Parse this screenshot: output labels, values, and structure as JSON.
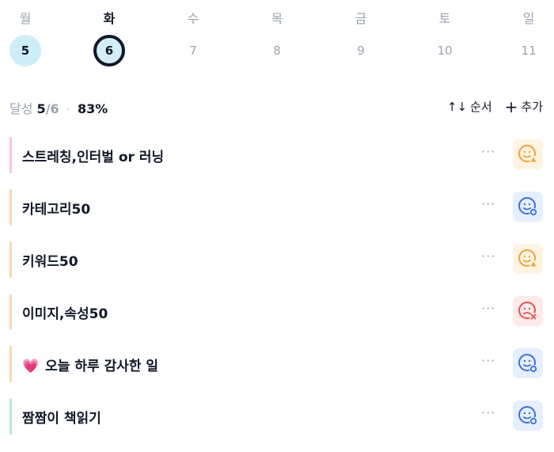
{
  "week": [
    {
      "day": "월",
      "date": "5",
      "state": "done"
    },
    {
      "day": "화",
      "date": "6",
      "state": "today"
    },
    {
      "day": "수",
      "date": "7",
      "state": "future"
    },
    {
      "day": "목",
      "date": "8",
      "state": "future"
    },
    {
      "day": "금",
      "date": "9",
      "state": "future"
    },
    {
      "day": "토",
      "date": "10",
      "state": "future"
    },
    {
      "day": "일",
      "date": "11",
      "state": "future"
    }
  ],
  "summary": {
    "label": "달성",
    "count": "5",
    "total": "/6",
    "separator": "·",
    "percent": "83%"
  },
  "toolbar": {
    "sort_icon": "↑↓",
    "sort_label": "순서",
    "add_icon": "+",
    "add_label": "추가"
  },
  "habits": [
    {
      "title": "스트레칭,인터벌 or 러닝",
      "accent": "#f4c4e4",
      "status": "warn",
      "status_icon": "smile-warning-icon"
    },
    {
      "title": "카테고리50",
      "accent": "#f6d9b3",
      "status": "ok",
      "status_icon": "smile-check-icon"
    },
    {
      "title": "키워드50",
      "accent": "#f6d9b3",
      "status": "warn",
      "status_icon": "smile-warning-icon"
    },
    {
      "title": "이미지,속성50",
      "accent": "#f6d9b3",
      "status": "fail",
      "status_icon": "smile-fail-icon"
    },
    {
      "title": "오늘 하루 감사한 일",
      "emoji": "💗",
      "accent": "#f6d9b3",
      "status": "ok",
      "status_icon": "smile-check-icon"
    },
    {
      "title": "짬짬이 책읽기",
      "accent": "#b8ead6",
      "status": "ok",
      "status_icon": "smile-check-icon"
    }
  ],
  "more_label": "···",
  "colors": {
    "warn": "#f0a23a",
    "ok": "#3b6fe0",
    "fail": "#e05555"
  }
}
